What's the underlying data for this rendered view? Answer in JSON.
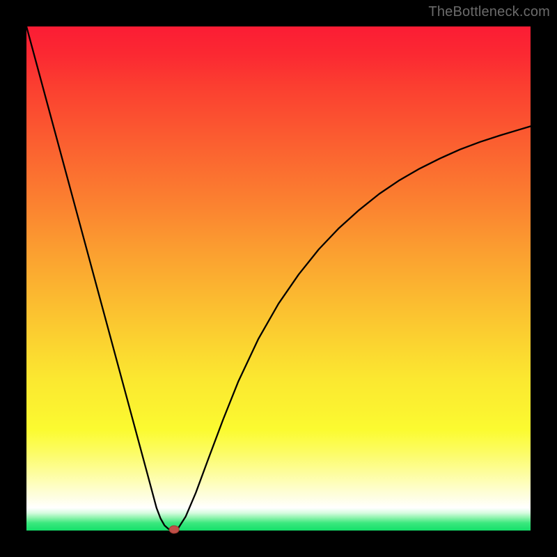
{
  "watermark": "TheBottleneck.com",
  "colors": {
    "frame": "#000000",
    "curve": "#000000",
    "marker_fill": "#c05048",
    "marker_stroke": "#a03830"
  },
  "chart_data": {
    "type": "line",
    "title": "",
    "xlabel": "",
    "ylabel": "",
    "xlim": [
      0,
      1
    ],
    "ylim": [
      0,
      1
    ],
    "x": [
      0.0,
      0.02,
      0.04,
      0.06,
      0.08,
      0.1,
      0.12,
      0.14,
      0.16,
      0.18,
      0.2,
      0.22,
      0.24,
      0.258,
      0.266,
      0.274,
      0.282,
      0.29,
      0.3,
      0.316,
      0.336,
      0.36,
      0.39,
      0.42,
      0.46,
      0.5,
      0.54,
      0.58,
      0.62,
      0.66,
      0.7,
      0.74,
      0.78,
      0.82,
      0.86,
      0.9,
      0.94,
      0.98,
      1.0
    ],
    "y": [
      1.0,
      0.926,
      0.852,
      0.778,
      0.704,
      0.63,
      0.556,
      0.482,
      0.408,
      0.334,
      0.26,
      0.186,
      0.112,
      0.045,
      0.024,
      0.01,
      0.003,
      0.0,
      0.003,
      0.028,
      0.075,
      0.14,
      0.22,
      0.295,
      0.38,
      0.45,
      0.508,
      0.558,
      0.6,
      0.636,
      0.668,
      0.695,
      0.718,
      0.738,
      0.756,
      0.771,
      0.784,
      0.796,
      0.802
    ],
    "marker": {
      "x": 0.293,
      "y": 0.002
    },
    "gradient_stops": [
      {
        "pos": 0.0,
        "color": "#fb1c34"
      },
      {
        "pos": 0.5,
        "color": "#fbc030"
      },
      {
        "pos": 0.8,
        "color": "#fbfb30"
      },
      {
        "pos": 0.95,
        "color": "#ffffff"
      },
      {
        "pos": 1.0,
        "color": "#15e06a"
      }
    ]
  }
}
